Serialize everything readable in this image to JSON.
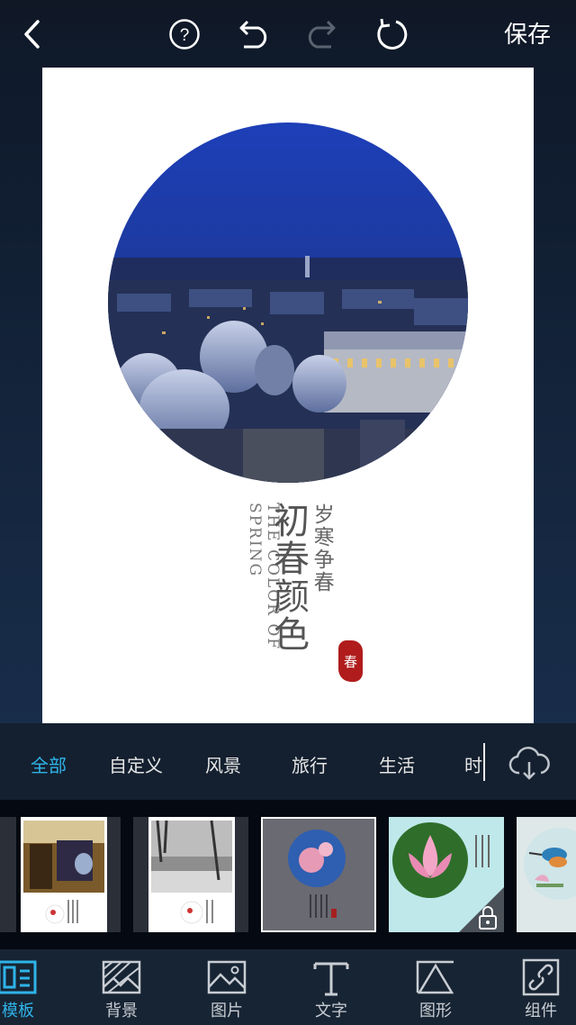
{
  "toolbar": {
    "save_label": "保存"
  },
  "poster": {
    "english_title": "THE COLOR OF SPRING",
    "main_title": "初春颜色",
    "sub_title": "岁寒争春",
    "seal_text": "春"
  },
  "categories": [
    {
      "label": "全部",
      "active": true
    },
    {
      "label": "自定义"
    },
    {
      "label": "风景"
    },
    {
      "label": "旅行"
    },
    {
      "label": "生活"
    },
    {
      "label": "时"
    }
  ],
  "tabs": [
    {
      "label": "模板",
      "icon": "template-icon",
      "active": true
    },
    {
      "label": "背景",
      "icon": "background-icon"
    },
    {
      "label": "图片",
      "icon": "image-icon"
    },
    {
      "label": "文字",
      "icon": "text-icon"
    },
    {
      "label": "图形",
      "icon": "shape-icon"
    },
    {
      "label": "组件",
      "icon": "component-icon"
    }
  ],
  "colors": {
    "accent": "#2fb3e8",
    "seal": "#b01c1c",
    "background": "#0f1a2b"
  }
}
